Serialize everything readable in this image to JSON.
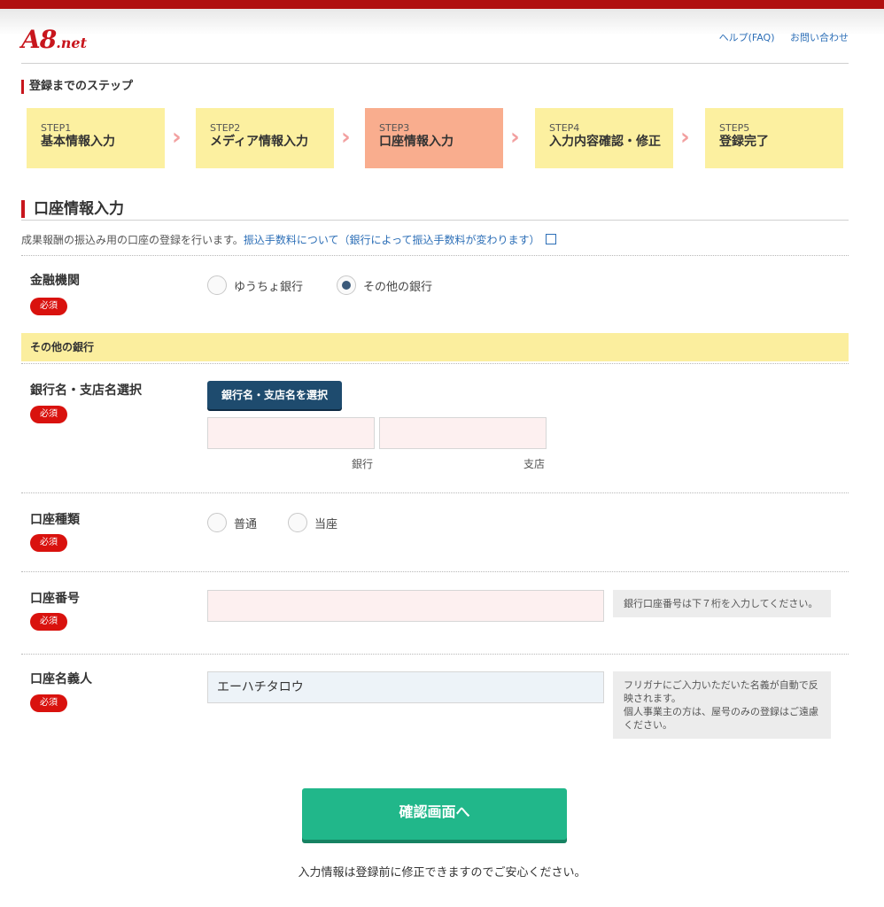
{
  "header": {
    "logo": "A8.net",
    "logo_main": "A8",
    "logo_suffix": ".net",
    "links": [
      "ヘルプ(FAQ)",
      "お問い合わせ"
    ]
  },
  "steps_title": "登録までのステップ",
  "steps": [
    {
      "num": "STEP1",
      "label": "基本情報入力"
    },
    {
      "num": "STEP2",
      "label": "メディア情報入力"
    },
    {
      "num": "STEP3",
      "label": "口座情報入力"
    },
    {
      "num": "STEP4",
      "label": "入力内容確認・修正"
    },
    {
      "num": "STEP5",
      "label": "登録完了"
    }
  ],
  "active_step": 3,
  "section_title": "口座情報入力",
  "intro_text": "成果報酬の振込み用の口座の登録を行います。",
  "intro_link": "振込手数料について（銀行によって振込手数料が変わります）",
  "required_label": "必須",
  "fields": {
    "institution": {
      "label": "金融機関",
      "options": [
        "ゆうちょ銀行",
        "その他の銀行"
      ],
      "selected": "その他の銀行"
    },
    "other_bank_band": "その他の銀行",
    "bank_branch": {
      "label": "銀行名・支店名選択",
      "button": "銀行名・支店名を選択",
      "bank_value": "",
      "branch_value": "",
      "bank_caption": "銀行",
      "branch_caption": "支店"
    },
    "account_type": {
      "label": "口座種類",
      "options": [
        "普通",
        "当座"
      ],
      "selected": ""
    },
    "account_number": {
      "label": "口座番号",
      "value": "",
      "hint": "銀行口座番号は下７桁を入力してください。"
    },
    "account_holder": {
      "label": "口座名義人",
      "value": "エーハチタロウ",
      "hint_1": "フリガナにご入力いただいた名義が自動で反映されます。",
      "hint_2": "個人事業主の方は、屋号のみの登録はご遠慮ください。"
    }
  },
  "submit_label": "確認画面へ",
  "footer_note": "入力情報は登録前に修正できますのでご安心ください。",
  "colors": {
    "brand_red": "#c8161d",
    "step_bg": "#fcf0a0",
    "step_active_bg": "#f9ad8e",
    "submit_green": "#21b78a",
    "link_blue": "#2d6fb7"
  }
}
